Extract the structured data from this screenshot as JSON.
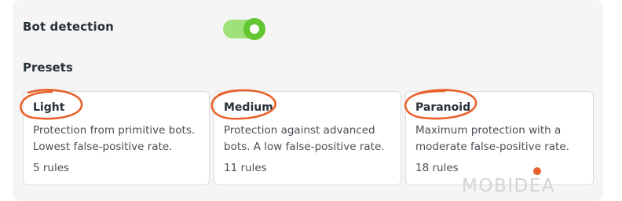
{
  "bot_detection": {
    "label": "Bot detection",
    "enabled": true
  },
  "presets": {
    "title": "Presets",
    "items": [
      {
        "name": "Light",
        "description": "Protection from primitive bots. Lowest false-positive rate.",
        "rules": "5 rules"
      },
      {
        "name": "Medium",
        "description": "Protection against advanced bots. A low false-positive rate.",
        "rules": "11 rules"
      },
      {
        "name": "Paranoid",
        "description": "Maximum protection with a moderate false-positive rate.",
        "rules": "18 rules"
      }
    ]
  },
  "annotation_color": "#e8612c",
  "toggle_color": "#63c531",
  "watermark": "MOBIDEA"
}
